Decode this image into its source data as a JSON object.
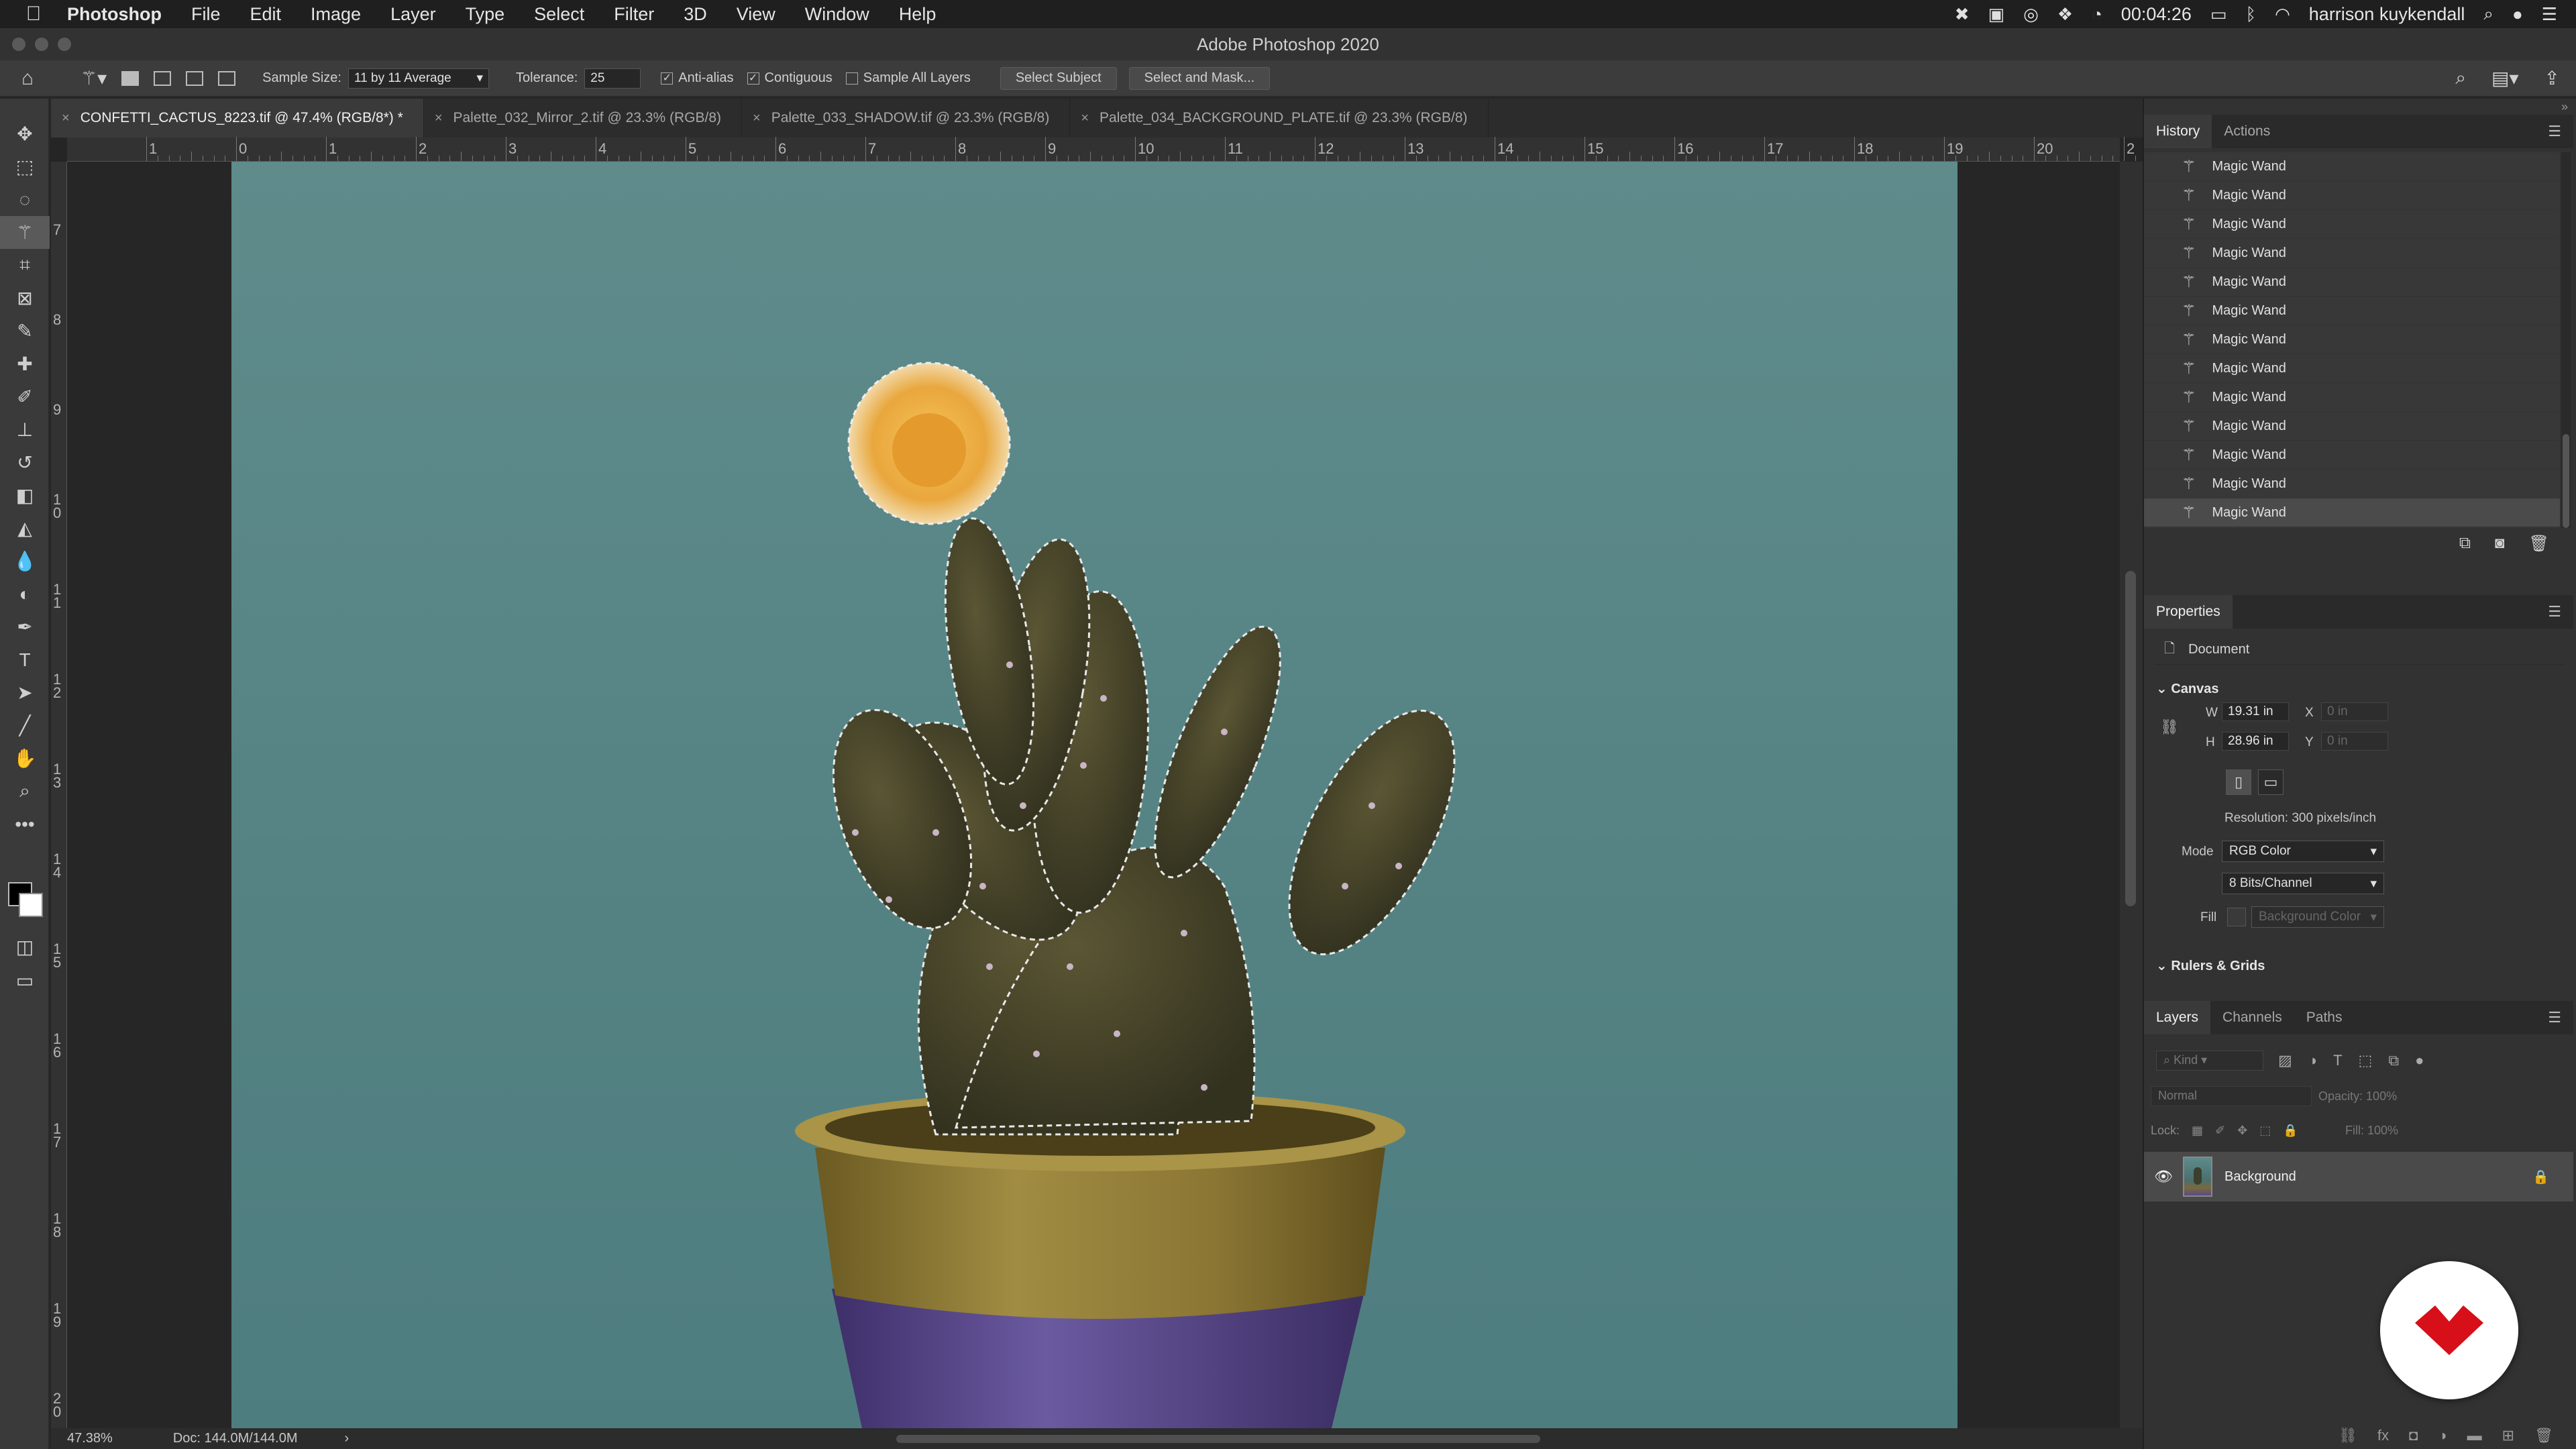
{
  "menubar": {
    "app": "Photoshop",
    "items": [
      "File",
      "Edit",
      "Image",
      "Layer",
      "Type",
      "Select",
      "Filter",
      "3D",
      "View",
      "Window",
      "Help"
    ],
    "clock": "00:04:26",
    "user": "harrison kuykendall"
  },
  "window": {
    "title": "Adobe Photoshop 2020"
  },
  "options": {
    "sample_size_label": "Sample Size:",
    "sample_size_value": "11 by 11 Average",
    "tolerance_label": "Tolerance:",
    "tolerance_value": "25",
    "anti_alias": {
      "label": "Anti-alias",
      "checked": true
    },
    "contiguous": {
      "label": "Contiguous",
      "checked": true
    },
    "sample_all_layers": {
      "label": "Sample All Layers",
      "checked": false
    },
    "select_subject": "Select Subject",
    "select_and_mask": "Select and Mask..."
  },
  "tabs": [
    {
      "label": "CONFETTI_CACTUS_8223.tif @ 47.4% (RGB/8*) *",
      "active": true
    },
    {
      "label": "Palette_032_Mirror_2.tif @ 23.3% (RGB/8)",
      "active": false
    },
    {
      "label": "Palette_033_SHADOW.tif @ 23.3% (RGB/8)",
      "active": false
    },
    {
      "label": "Palette_034_BACKGROUND_PLATE.tif @ 23.3% (RGB/8)",
      "active": false
    }
  ],
  "rulers": {
    "horizontal": [
      "1",
      "0",
      "1",
      "2",
      "3",
      "4",
      "5",
      "6",
      "7",
      "8",
      "9",
      "10",
      "11",
      "12",
      "13",
      "14",
      "15",
      "16",
      "17",
      "18",
      "19",
      "20",
      "2"
    ],
    "vertical": [
      "7",
      "8",
      "9",
      "1 0",
      "1 1",
      "1 2",
      "1 3",
      "1 4",
      "1 5",
      "1 6",
      "1 7",
      "1 8",
      "1 9",
      "2 0"
    ]
  },
  "status": {
    "zoom": "47.38%",
    "doc": "Doc: 144.0M/144.0M"
  },
  "history": {
    "tabs": [
      "History",
      "Actions"
    ],
    "items": [
      "Magic Wand",
      "Magic Wand",
      "Magic Wand",
      "Magic Wand",
      "Magic Wand",
      "Magic Wand",
      "Magic Wand",
      "Magic Wand",
      "Magic Wand",
      "Magic Wand",
      "Magic Wand",
      "Magic Wand",
      "Magic Wand"
    ]
  },
  "properties": {
    "tab": "Properties",
    "doc_label": "Document",
    "canvas_label": "Canvas",
    "w_label": "W",
    "w_value": "19.31 in",
    "h_label": "H",
    "h_value": "28.96 in",
    "x_label": "X",
    "x_value": "0 in",
    "y_label": "Y",
    "y_value": "0 in",
    "resolution": "Resolution: 300 pixels/inch",
    "mode_label": "Mode",
    "mode_value": "RGB Color",
    "depth_value": "8 Bits/Channel",
    "fill_label": "Fill",
    "fill_value": "Background Color",
    "rulers_label": "Rulers & Grids"
  },
  "layers": {
    "tabs": [
      "Layers",
      "Channels",
      "Paths"
    ],
    "kind": "Kind",
    "blend": "Normal",
    "opacity": "Opacity:",
    "opacity_value": "100%",
    "lock": "Lock:",
    "fill": "Fill:",
    "fill_value": "100%",
    "layer_name": "Background"
  },
  "colors": {
    "canvas": "#5f8b8b",
    "panel": "#323232",
    "accent": "#d60f19"
  }
}
